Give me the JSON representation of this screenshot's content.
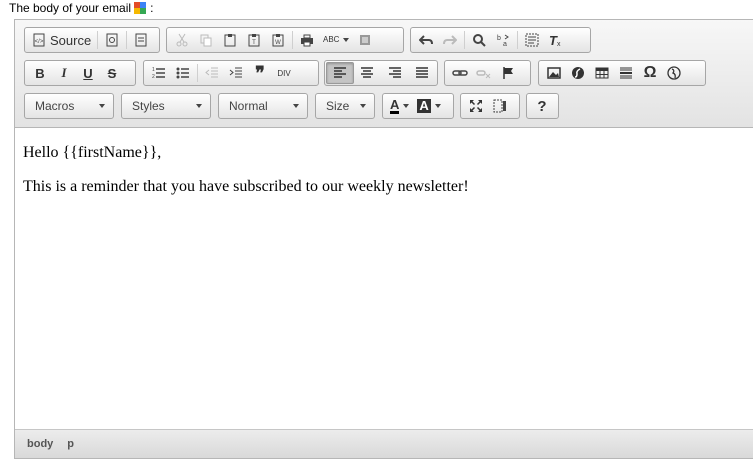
{
  "field": {
    "label": "The body of your email",
    "suffix": ":"
  },
  "toolbar": {
    "source_label": "Source",
    "combos": {
      "macros": "Macros",
      "styles": "Styles",
      "format": "Normal",
      "size": "Size"
    },
    "bold": "B",
    "italic": "I",
    "underline": "U",
    "strike": "S",
    "blockquote": "❞",
    "special_char": "Ω",
    "help": "?",
    "text_color": "A",
    "bg_color": "A",
    "spellcheck": "ABC",
    "div": "DIV"
  },
  "content": {
    "paragraphs": [
      "Hello {{firstName}},",
      "This is a reminder that you have subscribed to our weekly newsletter!"
    ]
  },
  "statusbar": {
    "path": [
      "body",
      "p"
    ]
  }
}
